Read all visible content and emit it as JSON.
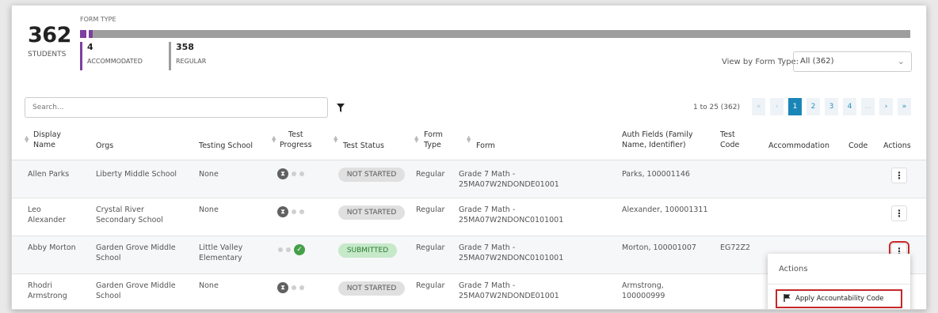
{
  "summary": {
    "total": "362",
    "total_label": "STUDENTS",
    "form_type_label": "FORM TYPE",
    "accommodated_count": "4",
    "accommodated_label": "ACCOMMODATED",
    "regular_count": "358",
    "regular_label": "REGULAR",
    "accommodated_fraction": 0.011,
    "colors": {
      "accommodated": "#7d3fa0",
      "regular": "#9e9e9e"
    }
  },
  "view_by": {
    "label": "View by Form Type:",
    "selected": "All (362)"
  },
  "toolbar": {
    "search_placeholder": "Search...",
    "filter_icon": "filter-icon",
    "range_text": "1 to 25 (362)"
  },
  "pagination": {
    "first": "«",
    "prev": "‹",
    "pages": [
      "1",
      "2",
      "3",
      "4"
    ],
    "active_page": "1",
    "ellipsis": "...",
    "next": "›",
    "last": "»"
  },
  "columns": {
    "display_name": [
      "Display",
      "Name"
    ],
    "orgs": "Orgs",
    "testing_school": "Testing School",
    "test_progress": [
      "Test",
      "Progress"
    ],
    "test_status": "Test Status",
    "form_type": [
      "Form",
      "Type"
    ],
    "form": "Form",
    "auth_fields": [
      "Auth Fields (Family",
      "Name, Identifier)"
    ],
    "test_code": [
      "Test",
      "Code"
    ],
    "accommodation": "Accommodation",
    "code": "Code",
    "actions": "Actions"
  },
  "rows": [
    {
      "name": [
        "Allen Parks"
      ],
      "orgs": [
        "Liberty Middle School"
      ],
      "testing_school": [
        "None"
      ],
      "progress": "not-started",
      "status": "NOT STARTED",
      "form_type": "Regular",
      "form": [
        "Grade 7 Math -",
        "25MA07W2NDONDE01001"
      ],
      "auth": [
        "Parks, 100001146"
      ],
      "test_code": "",
      "accommodation": "",
      "code": ""
    },
    {
      "name": [
        "Leo",
        "Alexander"
      ],
      "orgs": [
        "Crystal River",
        "Secondary School"
      ],
      "testing_school": [
        "None"
      ],
      "progress": "not-started",
      "status": "NOT STARTED",
      "form_type": "Regular",
      "form": [
        "Grade 7 Math -",
        "25MA07W2NDONC0101001"
      ],
      "auth": [
        "Alexander, 100001311"
      ],
      "test_code": "",
      "accommodation": "",
      "code": ""
    },
    {
      "name": [
        "Abby Morton"
      ],
      "orgs": [
        "Garden Grove Middle",
        "School"
      ],
      "testing_school": [
        "Little Valley",
        "Elementary"
      ],
      "progress": "submitted",
      "status": "SUBMITTED",
      "form_type": "Regular",
      "form": [
        "Grade 7 Math -",
        "25MA07W2NDONC0101001"
      ],
      "auth": [
        "Morton, 100001007"
      ],
      "test_code": "EG72Z2",
      "accommodation": "",
      "code": ""
    },
    {
      "name": [
        "Rhodri",
        "Armstrong"
      ],
      "orgs": [
        "Garden Grove Middle",
        "School"
      ],
      "testing_school": [
        "None"
      ],
      "progress": "not-started",
      "status": "NOT STARTED",
      "form_type": "Regular",
      "form": [
        "Grade 7 Math -",
        "25MA07W2NDONDE01001"
      ],
      "auth": [
        "Armstrong,",
        "100000999"
      ],
      "test_code": "",
      "accommodation": "",
      "code": ""
    }
  ],
  "actions_menu": {
    "title": "Actions",
    "item": "Apply Accountability Code",
    "item_icon": "flag-icon"
  }
}
